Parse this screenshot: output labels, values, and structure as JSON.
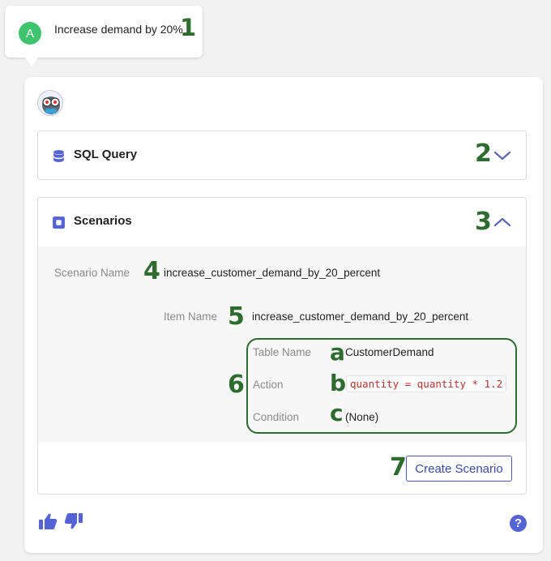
{
  "user_message": {
    "avatar_letter": "A",
    "text": "Increase demand by 20%"
  },
  "annotations": {
    "n1": "1",
    "n2": "2",
    "n3": "3",
    "n4": "4",
    "n5": "5",
    "n6": "6",
    "n7": "7",
    "a": "a",
    "b": "b",
    "c": "c"
  },
  "sql_panel": {
    "title": "SQL Query",
    "state": "collapsed"
  },
  "scenarios_panel": {
    "title": "Scenarios",
    "state": "expanded",
    "scenario_name_label": "Scenario Name",
    "scenario_name_value": "increase_customer_demand_by_20_percent",
    "item_name_label": "Item Name",
    "item_name_value": "increase_customer_demand_by_20_percent",
    "table_name_label": "Table Name",
    "table_name_value": "CustomerDemand",
    "action_label": "Action",
    "action_value": "quantity = quantity * 1.2",
    "condition_label": "Condition",
    "condition_value": "(None)",
    "create_button": "Create Scenario"
  },
  "footer": {
    "help_label": "?"
  },
  "colors": {
    "accent": "#5563d4",
    "annotation": "#2e6b2e",
    "avatar_green": "#3ec46d",
    "code_red": "#b7322f"
  }
}
